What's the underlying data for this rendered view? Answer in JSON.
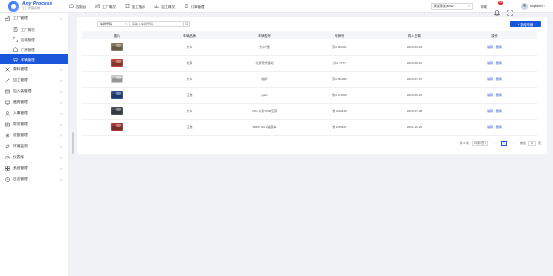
{
  "brand": {
    "name": "Any Process",
    "subtitle": "工厂管理系统"
  },
  "topnav": [
    {
      "label": "控制台"
    },
    {
      "label": "工厂概况"
    },
    {
      "label": "加工指示"
    },
    {
      "label": "加工概况"
    },
    {
      "label": "订单管理"
    }
  ],
  "topbar": {
    "tenant": "测试测试(BSW...",
    "help": "帮助",
    "notification_count": "10",
    "user_name": "anylaimi"
  },
  "sidebar": [
    {
      "type": "group",
      "label": "工厂管理",
      "chevron": "˄",
      "icon": "factory-icon"
    },
    {
      "type": "sub",
      "label": "工厂概况",
      "icon": "building-icon"
    },
    {
      "type": "sub",
      "label": "区域管理",
      "icon": "area-icon"
    },
    {
      "type": "sub",
      "label": "厂房管理",
      "icon": "plant-icon"
    },
    {
      "type": "sub",
      "label": "车辆管理",
      "icon": "vehicle-icon",
      "active": true
    },
    {
      "type": "group",
      "label": "原料管理",
      "chevron": "˅",
      "icon": "material-icon"
    },
    {
      "type": "group",
      "label": "加工管理",
      "chevron": "˅",
      "icon": "tool-icon"
    },
    {
      "type": "group",
      "label": "加入装管理",
      "chevron": "˅",
      "icon": "package-icon"
    },
    {
      "type": "group",
      "label": "器具管理",
      "chevron": "˅",
      "icon": "device-icon"
    },
    {
      "type": "group",
      "label": "人事管理",
      "chevron": "˅",
      "icon": "person-icon"
    },
    {
      "type": "group",
      "label": "财务管理",
      "chevron": "˅",
      "icon": "finance-icon"
    },
    {
      "type": "group",
      "label": "设备管理",
      "chevron": "˅",
      "icon": "gear-icon"
    },
    {
      "type": "group",
      "label": "环境监测",
      "chevron": "˅",
      "icon": "environment-icon"
    },
    {
      "type": "group",
      "label": "仪表库",
      "chevron": "˅",
      "icon": "dashboard-icon"
    },
    {
      "type": "group",
      "label": "系统管理",
      "chevron": "˅",
      "icon": "settings-icon"
    },
    {
      "type": "group",
      "label": "日志管理",
      "chevron": "˅",
      "icon": "log-icon"
    }
  ],
  "toolbar": {
    "filter_select": "车牌号码",
    "search_placeholder": "请输入车牌号码",
    "add_button": "+ 新增车辆"
  },
  "table": {
    "headers": [
      "图片",
      "车辆品牌",
      "车辆型号",
      "车牌号",
      "购入日期",
      "操作"
    ],
    "rows": [
      {
        "image_color": "#8a7a62",
        "brand": "大众",
        "model": "大众T型",
        "plate": "京A·B0421",
        "date": "2023-09-18"
      },
      {
        "image_color": "#b5483c",
        "brand": "北京",
        "model": "北京现代悦动",
        "plate": "沪A·7777",
        "date": "2023-08-01"
      },
      {
        "image_color": "#c9c9c9",
        "brand": "大众",
        "model": "帕萨",
        "plate": "京A·B1282",
        "date": "2023-07-07"
      },
      {
        "image_color": "#2b4f8f",
        "brand": "江淮",
        "model": "gato",
        "plate": "鲁A·D1502",
        "date": "2023-05-01"
      },
      {
        "image_color": "#4a5058",
        "brand": "大众",
        "model": "VIKI 众泰T500空调",
        "plate": "鲁 H60448",
        "date": "2022-07-08"
      },
      {
        "image_color": "#a13a35",
        "brand": "江淮",
        "model": "BMW G9-3速度车",
        "plate": "鲁 D05947",
        "date": "2021-12-25"
      }
    ],
    "actions": {
      "edit": "编辑",
      "delete": "删除"
    }
  },
  "pagination": {
    "total": "共 6 条",
    "page_size": "10条/页",
    "prev": "‹",
    "current_page": "1",
    "next": "›",
    "goto_label": "前往",
    "goto_value": "1",
    "page_suffix": "页"
  },
  "colors": {
    "accent": "#1a56db",
    "danger": "#f5222d"
  }
}
